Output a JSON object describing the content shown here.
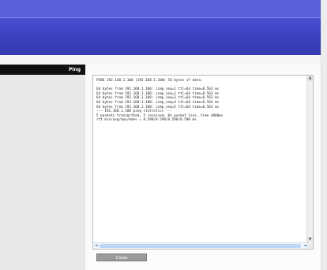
{
  "nav": {
    "active_item": "Ping"
  },
  "output": {
    "lines": [
      "PING 192.168.1.100 (192.168.1.100) 56 bytes of data.",
      "",
      "64 bytes from 192.168.1.100: icmp_seq=1 ttl=64 time=0.563 ms",
      "64 bytes from 192.168.1.100: icmp_seq=2 ttl=64 time=0.563 ms",
      "64 bytes from 192.168.1.100: icmp_seq=3 ttl=64 time=0.563 ms",
      "64 bytes from 192.168.1.100: icmp_seq=4 ttl=64 time=0.563 ms",
      "64 bytes from 192.168.1.100: icmp_seq=5 ttl=64 time=0.563 ms",
      "--- 192.168.1.100 ping statistics ---",
      "5 packets transmitted, 5 received, 0% packet loss, time 4000ms",
      "rtt min/avg/max/mdev = 0.590/0.590/0.590/0.590 ms"
    ]
  },
  "scroll": {
    "up": "▲",
    "down": "▼",
    "left": "◄",
    "right": "►"
  },
  "buttons": {
    "close": "Close"
  }
}
